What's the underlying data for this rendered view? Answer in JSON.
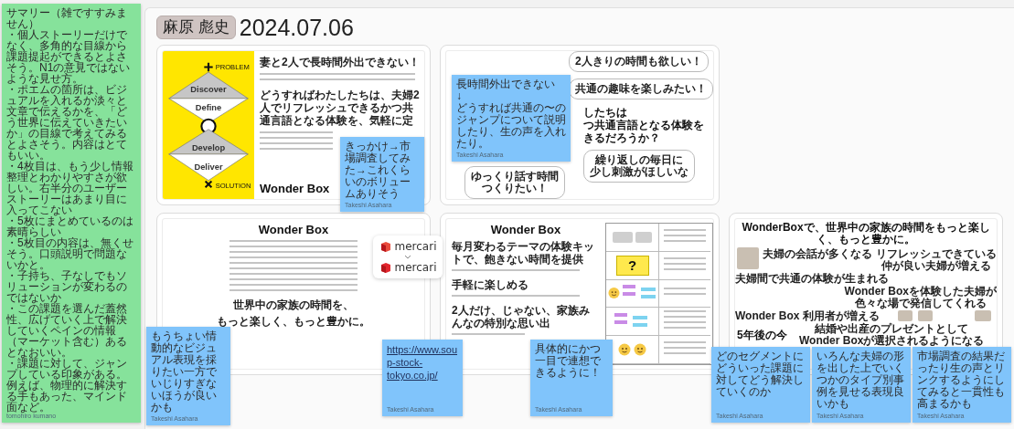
{
  "header": {
    "name_tag": "麻原 彪史",
    "date": "2024.07.06"
  },
  "slides": [
    {
      "kind": "problem",
      "diagram": {
        "top": "PROBLEM",
        "stages": [
          "Discover",
          "Define",
          "Develop",
          "Deliver"
        ],
        "bottom": "SOLUTION"
      },
      "heading": "妻と2人で長時間外出できない！",
      "question": "どうすればわたしたちは、夫婦2人でリフレッシュできるかつ共通言語となる体験を、気軽に定",
      "brand": "Wonder Box"
    },
    {
      "kind": "bubbles",
      "bubbles": [
        {
          "lines": [
            "2人きりの時間も欲しい！"
          ]
        },
        {
          "lines": [
            "共通の趣味を楽しみたい！"
          ]
        },
        {
          "lines": [
            "ゆっくり話す時間",
            "つくりたい！"
          ]
        },
        {
          "lines": [
            "繰り返しの毎日に",
            "少し刺激がほしいな"
          ]
        }
      ],
      "question_lines": [
        "したちは",
        "つ共通言語となる体験を",
        "きるだろうか？"
      ]
    },
    {
      "kind": "story",
      "title": "Wonder Box",
      "closing_lines": [
        "世界中の家族の時間を、",
        "もっと楽しく、もっと豊かに。"
      ]
    },
    {
      "kind": "features",
      "title": "Wonder Box",
      "features": [
        "毎月変わるテーマの体験キットで、飽きない時間を提供",
        "手軽に楽しめる",
        "2人だけ、じゃない、家族みんなの特別な思い出"
      ],
      "storyboard_mark": "?"
    },
    {
      "kind": "loop",
      "title": "WonderBoxで、世界中の家族の時間をもっと楽しく、もっと豊かに。",
      "nodes": [
        {
          "lines": [
            "夫婦の会話が多くなる"
          ]
        },
        {
          "lines": [
            "リフレッシュできている",
            "仲が良い夫婦が増える"
          ]
        },
        {
          "lines": [
            "夫婦間で共通の体験が生まれる"
          ]
        },
        {
          "lines": [
            "Wonder Boxを体験した夫婦が",
            "色々な場で発信してくれる"
          ]
        },
        {
          "lines": [
            "Wonder Box 利用者が増える"
          ]
        },
        {
          "lines": [
            "結婚や出産のプレゼントとして",
            "Wonder Boxが選択されるようになる"
          ]
        }
      ],
      "footer": "5年後の今"
    }
  ],
  "logo_card": {
    "logos": [
      "mercari",
      "mercari"
    ]
  },
  "notes": [
    {
      "kind": "list",
      "color": "#86e29b",
      "author": "tomohiro kumano",
      "items": [
        "サマリー（雑ですすみません）",
        "・個人ストーリーだけでなく、多角的な目線から課題提起ができるとよさそう。N1の意見ではないような見せ方。",
        "・ポエムの箇所は、ビジュアルを入れるか淡々と文章で伝えるかを、「どう世界に伝えていきたいか」の目線で考えてみるとよさそう。内容はとてもいい。",
        "・4枚目は、もう少し情報整理とわかりやすさが欲しい。右半分のユーザーストーリーはあまり目に入ってこない",
        "・5枚にまとめているのは素晴らしい",
        "・5枚目の内容は、無くせそう。口頭説明で問題ないかと。",
        "・子持ち、子なしでもソリューションが変わるのではないか",
        "・この課題を選んだ蓋然性、広げていく上で解決していくペインの情報（マーケット含む）あるとなおいい。",
        "・課題に対して、ジャンプしている印象がある。例えば、物理的に解決する手もあった、マインド面など。"
      ]
    },
    {
      "kind": "text",
      "color": "#80c4fb",
      "author": "Takeshi Asahara",
      "text": "きっかけ→市場調査してみた→これくらいのボリュームありそう"
    },
    {
      "kind": "text",
      "color": "#80c4fb",
      "author": "Takeshi Asahara",
      "text": "長時間外出できない\n↓\nどうすれば共通の〜のジャンプについて説明したり、生の声を入れたり。"
    },
    {
      "kind": "text",
      "color": "#80c4fb",
      "author": "Takeshi Asahara",
      "text": "もうちょい情動的なビジュアル表現を採りたい一方でいじりすぎないほうが良いかも"
    },
    {
      "kind": "link",
      "color": "#80c4fb",
      "author": "Takeshi Asahara",
      "text": "https://www.soup-stock-tokyo.co.jp/"
    },
    {
      "kind": "text",
      "color": "#80c4fb",
      "author": "Takeshi Asahara",
      "text": "具体的にかつ一目で連想できるように！"
    },
    {
      "kind": "text",
      "color": "#80c4fb",
      "author": "Takeshi Asahara",
      "text": "どのセグメントにどういった課題に対してどう解決していくのか"
    },
    {
      "kind": "text",
      "color": "#80c4fb",
      "author": "Takeshi Asahara",
      "text": "いろんな夫婦の形を出した上でいくつかのタイプ別事例を見せる表現良いかも"
    },
    {
      "kind": "text",
      "color": "#80c4fb",
      "author": "Takeshi Asahara",
      "text": "市場調査の結果だったり生の声とリンクするようにしてみると一貫性も高まるかも"
    }
  ]
}
